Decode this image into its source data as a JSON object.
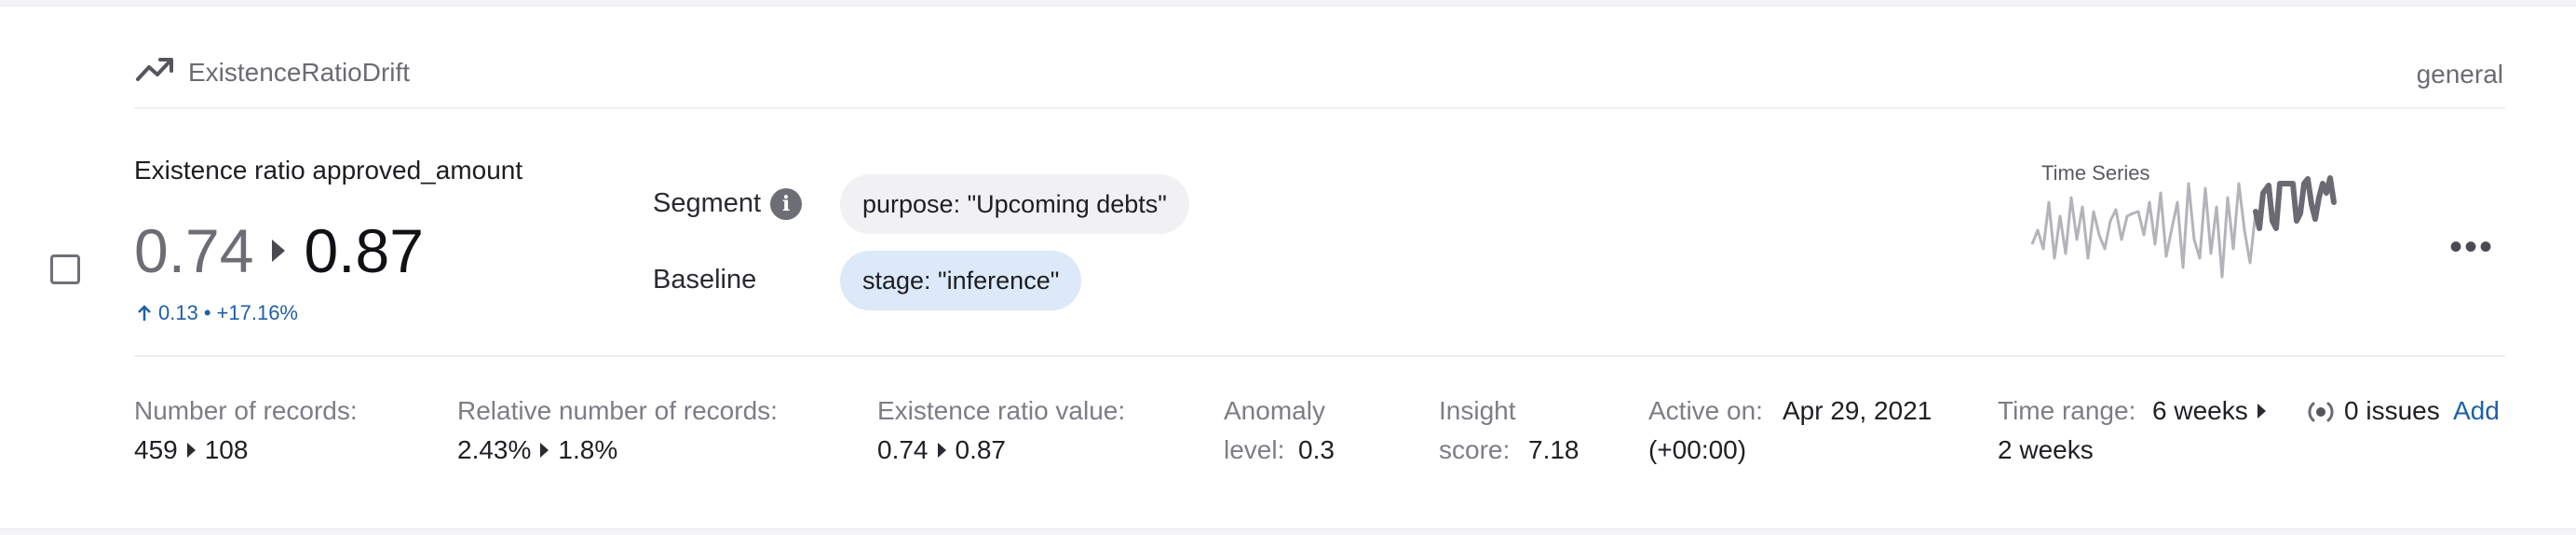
{
  "header": {
    "type_name": "ExistenceRatioDrift",
    "category": "general"
  },
  "insight": {
    "title": "Existence ratio approved_amount",
    "from_value": "0.74",
    "to_value": "0.87",
    "delta": "0.13",
    "delta_separator": "•",
    "delta_percent": "+17.16%"
  },
  "segment": {
    "label": "Segment",
    "info_glyph": "i",
    "value": "purpose: \"Upcoming debts\""
  },
  "baseline": {
    "label": "Baseline",
    "value": "stage: \"inference\""
  },
  "sparkline": {
    "title": "Time Series"
  },
  "menu": {
    "more_glyph": "•••"
  },
  "stats": {
    "records": {
      "label": "Number of records:",
      "from": "459",
      "to": "108"
    },
    "relative_records": {
      "label": "Relative number of records:",
      "from": "2.43%",
      "to": "1.8%"
    },
    "ratio_value": {
      "label": "Existence ratio value:",
      "from": "0.74",
      "to": "0.87"
    },
    "anomaly": {
      "label_line1": "Anomaly",
      "label_line2": "level:",
      "value": "0.3"
    },
    "insight_score": {
      "label_line1": "Insight",
      "label_line2": "score:",
      "value": "7.18"
    },
    "active_on": {
      "label": "Active on:",
      "date": "Apr 29, 2021",
      "tz": "(+00:00)"
    },
    "time_range": {
      "label": "Time range:",
      "from": "6 weeks",
      "to": "2 weeks"
    }
  },
  "issues": {
    "text": "0 issues",
    "add_label": "Add"
  },
  "colors": {
    "accent_blue": "#1f5fa8",
    "baseline_chip": "#dbe9f8",
    "segment_chip": "#f1f1f4",
    "spark_baseline": "#b3b3ba",
    "spark_segment": "#6a6a73"
  }
}
